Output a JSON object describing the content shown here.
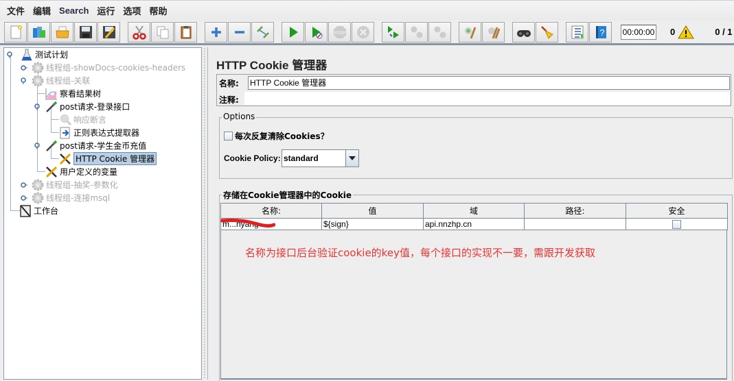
{
  "menubar": {
    "items": [
      "文件",
      "编辑",
      "Search",
      "运行",
      "选项",
      "帮助"
    ]
  },
  "toolbar": {
    "buttons": [
      {
        "icon": "new-icon",
        "label": "New"
      },
      {
        "icon": "templates-icon",
        "label": "Templates"
      },
      {
        "icon": "open-icon",
        "label": "Open"
      },
      {
        "icon": "save-icon",
        "label": "Save"
      },
      {
        "icon": "save-as-icon",
        "label": "Save As"
      },
      {
        "icon": "cut-icon",
        "label": "Cut"
      },
      {
        "icon": "copy-icon",
        "label": "Copy"
      },
      {
        "icon": "paste-icon",
        "label": "Paste"
      },
      {
        "icon": "expand-icon",
        "label": "Expand"
      },
      {
        "icon": "collapse-icon",
        "label": "Collapse"
      },
      {
        "icon": "toggle-icon",
        "label": "Toggle"
      },
      {
        "icon": "start-icon",
        "label": "Start"
      },
      {
        "icon": "start-no-pause-icon",
        "label": "Start no pauses"
      },
      {
        "icon": "stop-icon",
        "label": "Stop"
      },
      {
        "icon": "shutdown-icon",
        "label": "Shutdown"
      },
      {
        "icon": "remote-start-icon",
        "label": "Remote start"
      },
      {
        "icon": "remote-stop-icon",
        "label": "Remote stop"
      },
      {
        "icon": "remote-shutdown-icon",
        "label": "Remote shutdown"
      },
      {
        "icon": "clear-icon",
        "label": "Clear"
      },
      {
        "icon": "clear-all-icon",
        "label": "Clear all"
      },
      {
        "icon": "search-icon",
        "label": "Search"
      },
      {
        "icon": "reset-search-icon",
        "label": "Reset search"
      },
      {
        "icon": "function-helper-icon",
        "label": "Function helper"
      },
      {
        "icon": "help-icon",
        "label": "Help"
      }
    ],
    "timer": "00:00:00",
    "error_count": "0",
    "threads": "0 / 1"
  },
  "tree": {
    "items": [
      {
        "label": "测试计划",
        "icon": "test-plan-icon",
        "disabled": false
      },
      {
        "label": "线程组-showDocs-cookies-headers",
        "icon": "thread-group-icon",
        "disabled": true
      },
      {
        "label": "线程组-关联",
        "icon": "thread-group-icon",
        "disabled": true
      },
      {
        "label": "察看结果树",
        "icon": "results-tree-icon",
        "disabled": false
      },
      {
        "label": "post请求-登录接口",
        "icon": "sampler-icon",
        "disabled": false
      },
      {
        "label": "响应断言",
        "icon": "assertion-icon",
        "disabled": true
      },
      {
        "label": "正则表达式提取器",
        "icon": "extractor-icon",
        "disabled": false
      },
      {
        "label": "post请求-学生金币充值",
        "icon": "sampler-icon",
        "disabled": false
      },
      {
        "label": "HTTP Cookie 管理器",
        "icon": "config-icon",
        "disabled": false,
        "selected": true
      },
      {
        "label": "用户定义的变量",
        "icon": "config-icon",
        "disabled": false
      },
      {
        "label": "线程组-抽奖-参数化",
        "icon": "thread-group-icon",
        "disabled": true
      },
      {
        "label": "线程组-连接msql",
        "icon": "thread-group-icon",
        "disabled": true
      },
      {
        "label": "工作台",
        "icon": "workbench-icon",
        "disabled": false
      }
    ]
  },
  "panel": {
    "title": "HTTP Cookie 管理器",
    "name_label": "名称:",
    "name_value": "HTTP Cookie 管理器",
    "comment_label": "注释:",
    "comment_value": "",
    "options_legend": "Options",
    "clear_each_iteration_label": "每次反复清除Cookies？",
    "clear_each_iteration_checked": false,
    "cookie_policy_label": "Cookie Policy:",
    "cookie_policy_value": "standard",
    "stored_legend": "存储在Cookie管理器中的Cookie",
    "table": {
      "columns": [
        "名称:",
        "值",
        "域",
        "路径:",
        "安全"
      ],
      "rows": [
        {
          "name": "m...nyang",
          "value": "${sign}",
          "domain": "api.nnzhp.cn",
          "path": "",
          "secure": false
        }
      ]
    },
    "annotation": "名称为接口后台验证cookie的key值，每个接口的实现不一要，需跟开发获取",
    "annotation_color": "#ee3333"
  }
}
